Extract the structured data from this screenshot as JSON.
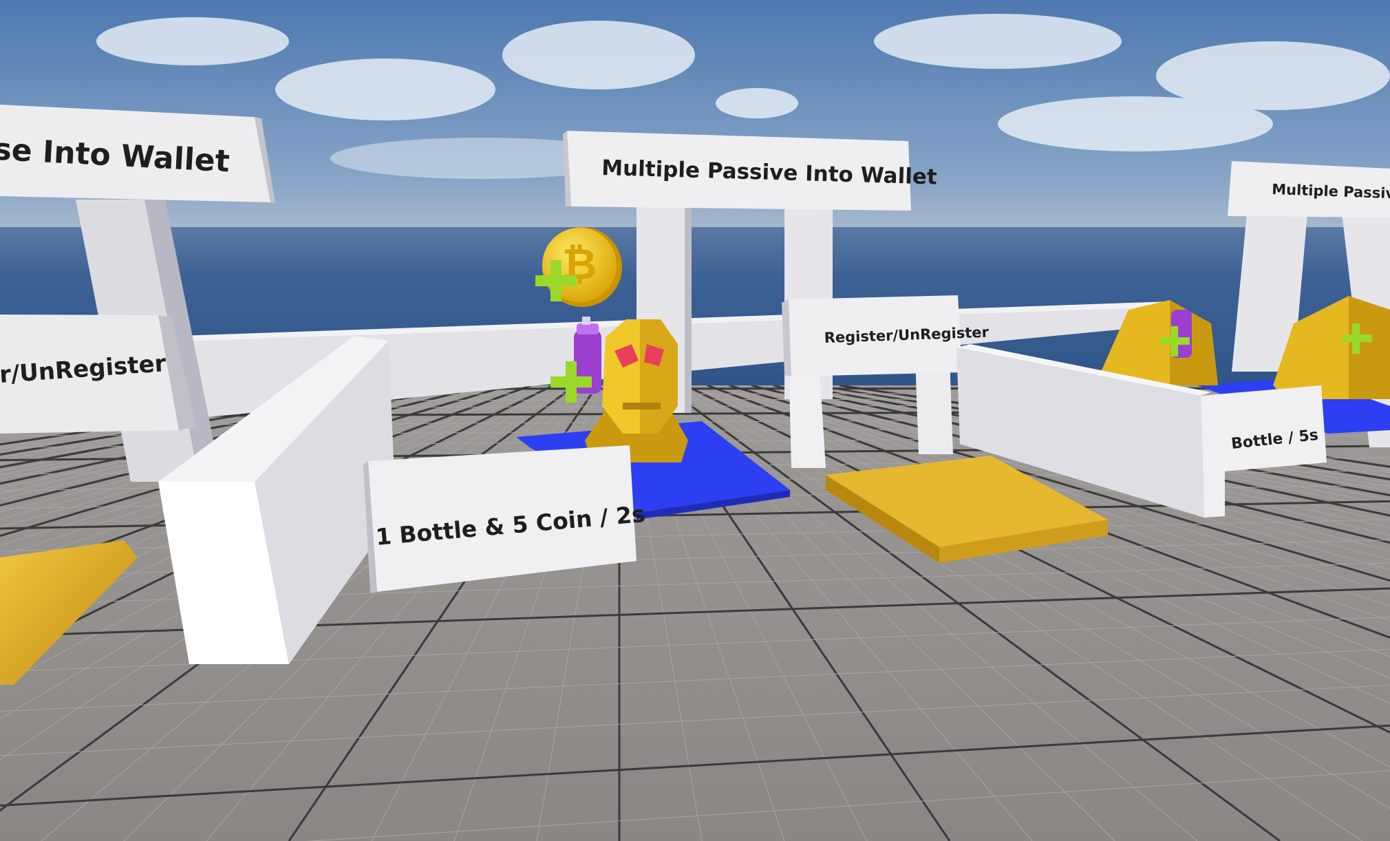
{
  "scene": {
    "signs": {
      "left_title": "se Into Wallet",
      "center_title": "Multiple Passive Into Wallet",
      "right_title": "Multiple Passive Into",
      "left_register": "r/UnRegister",
      "center_register": "Register/UnRegister",
      "center_rate": "1 Bottle & 5 Coin / 2s",
      "right_rate": "Bottle / 5s"
    },
    "icons": [
      "bitcoin-coin-icon",
      "plus-icon",
      "bottle-icon",
      "golden-head-statue"
    ],
    "colors": {
      "sky": "#5d84b8",
      "ocean": "#3a5f92",
      "floor": "#8e8b89",
      "wall": "#e4e3e6",
      "blue_pad": "#2a3ff0",
      "gold_pad": "#e2b230",
      "coin": "#f2c81c",
      "plus": "#9ad82a",
      "bottle": "#9b3fd0"
    }
  }
}
